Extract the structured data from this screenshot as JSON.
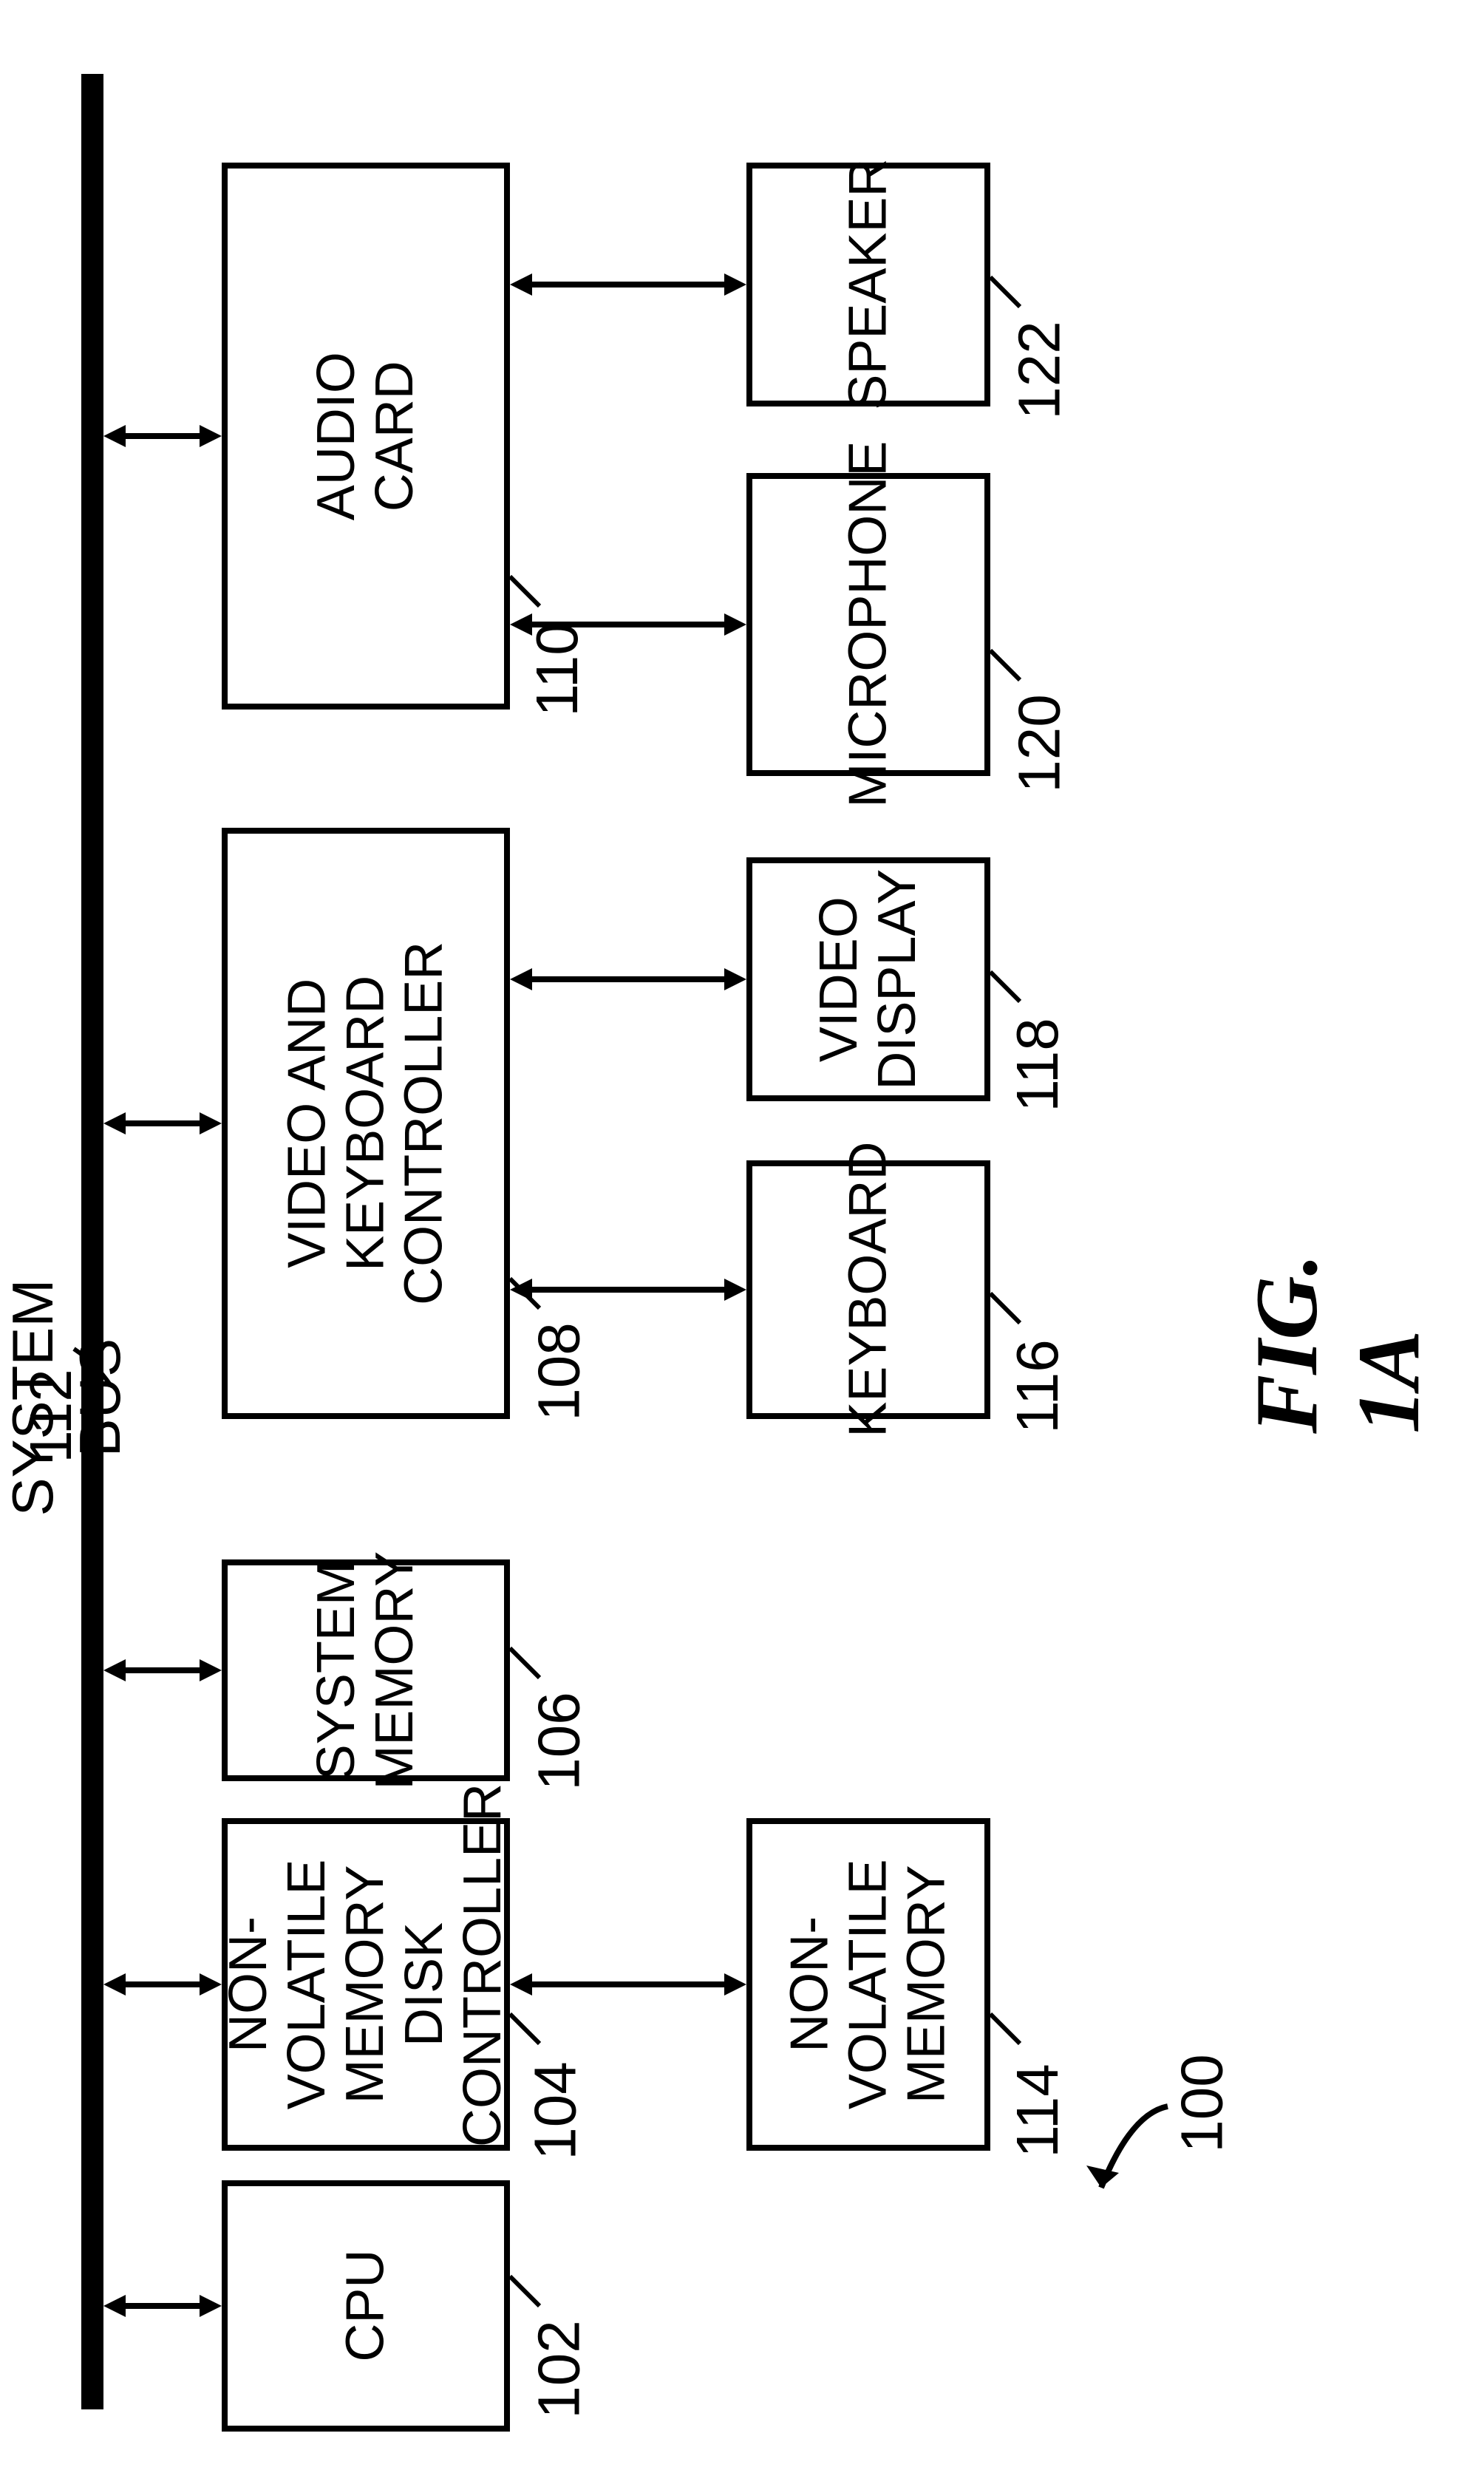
{
  "figure": {
    "title": "FIG. 1A",
    "assembly_ref": "100"
  },
  "bus": {
    "label": "SYSTEM BUS",
    "ref": "112"
  },
  "blocks": {
    "cpu": {
      "ref": "102",
      "label": "CPU"
    },
    "nvmdc": {
      "ref": "104",
      "label": "NON-VOLATILE\nMEMORY DISK\nCONTROLLER"
    },
    "sysmem": {
      "ref": "106",
      "label": "SYSTEM\nMEMORY"
    },
    "vkctrl": {
      "ref": "108",
      "label": "VIDEO AND\nKEYBOARD\nCONTROLLER"
    },
    "audio": {
      "ref": "110",
      "label": "AUDIO\nCARD"
    },
    "nvmem": {
      "ref": "114",
      "label": "NON-VOLATILE\nMEMORY"
    },
    "keyboard": {
      "ref": "116",
      "label": "KEYBOARD"
    },
    "vdisplay": {
      "ref": "118",
      "label": "VIDEO\nDISPLAY"
    },
    "microphone": {
      "ref": "120",
      "label": "MICROPHONE"
    },
    "speaker": {
      "ref": "122",
      "label": "SPEAKER"
    }
  }
}
